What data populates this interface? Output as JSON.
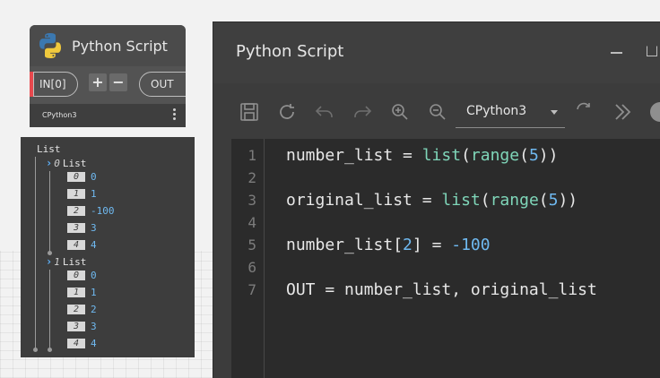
{
  "node": {
    "title": "Python Script",
    "input_port": "IN[0]",
    "add_label": "+",
    "remove_label": "−",
    "output_port": "OUT",
    "engine": "CPython3"
  },
  "watch": {
    "root_label": "List",
    "lists": [
      {
        "index": "0",
        "label": "List",
        "items": [
          {
            "index": "0",
            "value": "0"
          },
          {
            "index": "1",
            "value": "1"
          },
          {
            "index": "2",
            "value": "-100"
          },
          {
            "index": "3",
            "value": "3"
          },
          {
            "index": "4",
            "value": "4"
          }
        ]
      },
      {
        "index": "1",
        "label": "List",
        "items": [
          {
            "index": "0",
            "value": "0"
          },
          {
            "index": "1",
            "value": "1"
          },
          {
            "index": "2",
            "value": "2"
          },
          {
            "index": "3",
            "value": "3"
          },
          {
            "index": "4",
            "value": "4"
          }
        ]
      }
    ]
  },
  "editor": {
    "title": "Python Script",
    "engine_select": "CPython3",
    "lines": [
      {
        "n": "1",
        "tokens": [
          {
            "t": "number_list = ",
            "c": "plain"
          },
          {
            "t": "list",
            "c": "builtin"
          },
          {
            "t": "(",
            "c": "plain"
          },
          {
            "t": "range",
            "c": "builtin"
          },
          {
            "t": "(",
            "c": "plain"
          },
          {
            "t": "5",
            "c": "num"
          },
          {
            "t": "))",
            "c": "plain"
          }
        ]
      },
      {
        "n": "2",
        "tokens": []
      },
      {
        "n": "3",
        "tokens": [
          {
            "t": "original_list = ",
            "c": "plain"
          },
          {
            "t": "list",
            "c": "builtin"
          },
          {
            "t": "(",
            "c": "plain"
          },
          {
            "t": "range",
            "c": "builtin"
          },
          {
            "t": "(",
            "c": "plain"
          },
          {
            "t": "5",
            "c": "num"
          },
          {
            "t": "))",
            "c": "plain"
          }
        ]
      },
      {
        "n": "4",
        "tokens": []
      },
      {
        "n": "5",
        "tokens": [
          {
            "t": "number_list[",
            "c": "plain"
          },
          {
            "t": "2",
            "c": "num"
          },
          {
            "t": "] = ",
            "c": "plain"
          },
          {
            "t": "-100",
            "c": "num"
          }
        ]
      },
      {
        "n": "6",
        "tokens": []
      },
      {
        "n": "7",
        "tokens": [
          {
            "t": "OUT = number_list, original_list",
            "c": "plain"
          }
        ]
      }
    ]
  },
  "colors": {
    "accent_red": "#e8494e",
    "builtin": "#7fd6b9",
    "number": "#6fb9f0"
  }
}
